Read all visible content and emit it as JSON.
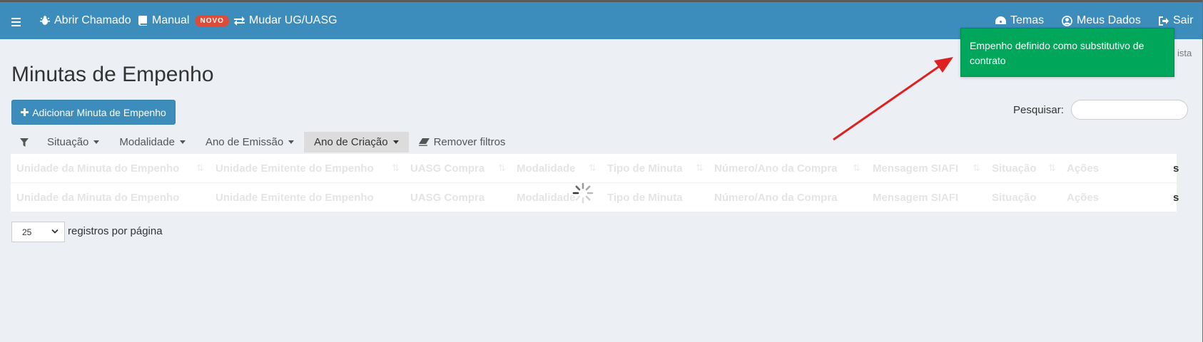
{
  "navbar": {
    "left": [
      {
        "label": "Abrir Chamado",
        "icon": "bug-icon"
      },
      {
        "label": "Manual",
        "icon": "book-icon",
        "badge": "NOVO"
      },
      {
        "label": "Mudar UG/UASG",
        "icon": "exchange-icon"
      }
    ],
    "right": [
      {
        "label": "Temas",
        "icon": "dashboard-icon"
      },
      {
        "label": "Meus Dados",
        "icon": "user-circle-icon"
      },
      {
        "label": "Sair",
        "icon": "sign-out-icon"
      }
    ]
  },
  "breadcrumb_tail": "ista",
  "page": {
    "title": "Minutas de Empenho",
    "add_button": "Adicionar Minuta de Empenho",
    "search_label": "Pesquisar:",
    "search_value": ""
  },
  "filters": {
    "items": [
      {
        "label": "Situação"
      },
      {
        "label": "Modalidade"
      },
      {
        "label": "Ano de Emissão"
      },
      {
        "label": "Ano de Criação",
        "active": true
      }
    ],
    "remove_label": "Remover filtros"
  },
  "table": {
    "columns": [
      "Unidade da Minuta do Empenho",
      "Unidade Emitente do Empenho",
      "UASG Compra",
      "Modalidade",
      "Tipo de Minuta",
      "Número/Ano da Compra",
      "Mensagem SIAFI",
      "Situação",
      "Ações"
    ],
    "edge_text": "s"
  },
  "pagination": {
    "page_size": "25",
    "per_page_label": "registros por página"
  },
  "toast": {
    "message": "Empenho definido como substitutivo de contrato"
  },
  "colors": {
    "navbar": "#3c8dbc",
    "toast": "#00a65a",
    "annotation_arrow": "#e02020",
    "badge": "#dd4b39"
  }
}
